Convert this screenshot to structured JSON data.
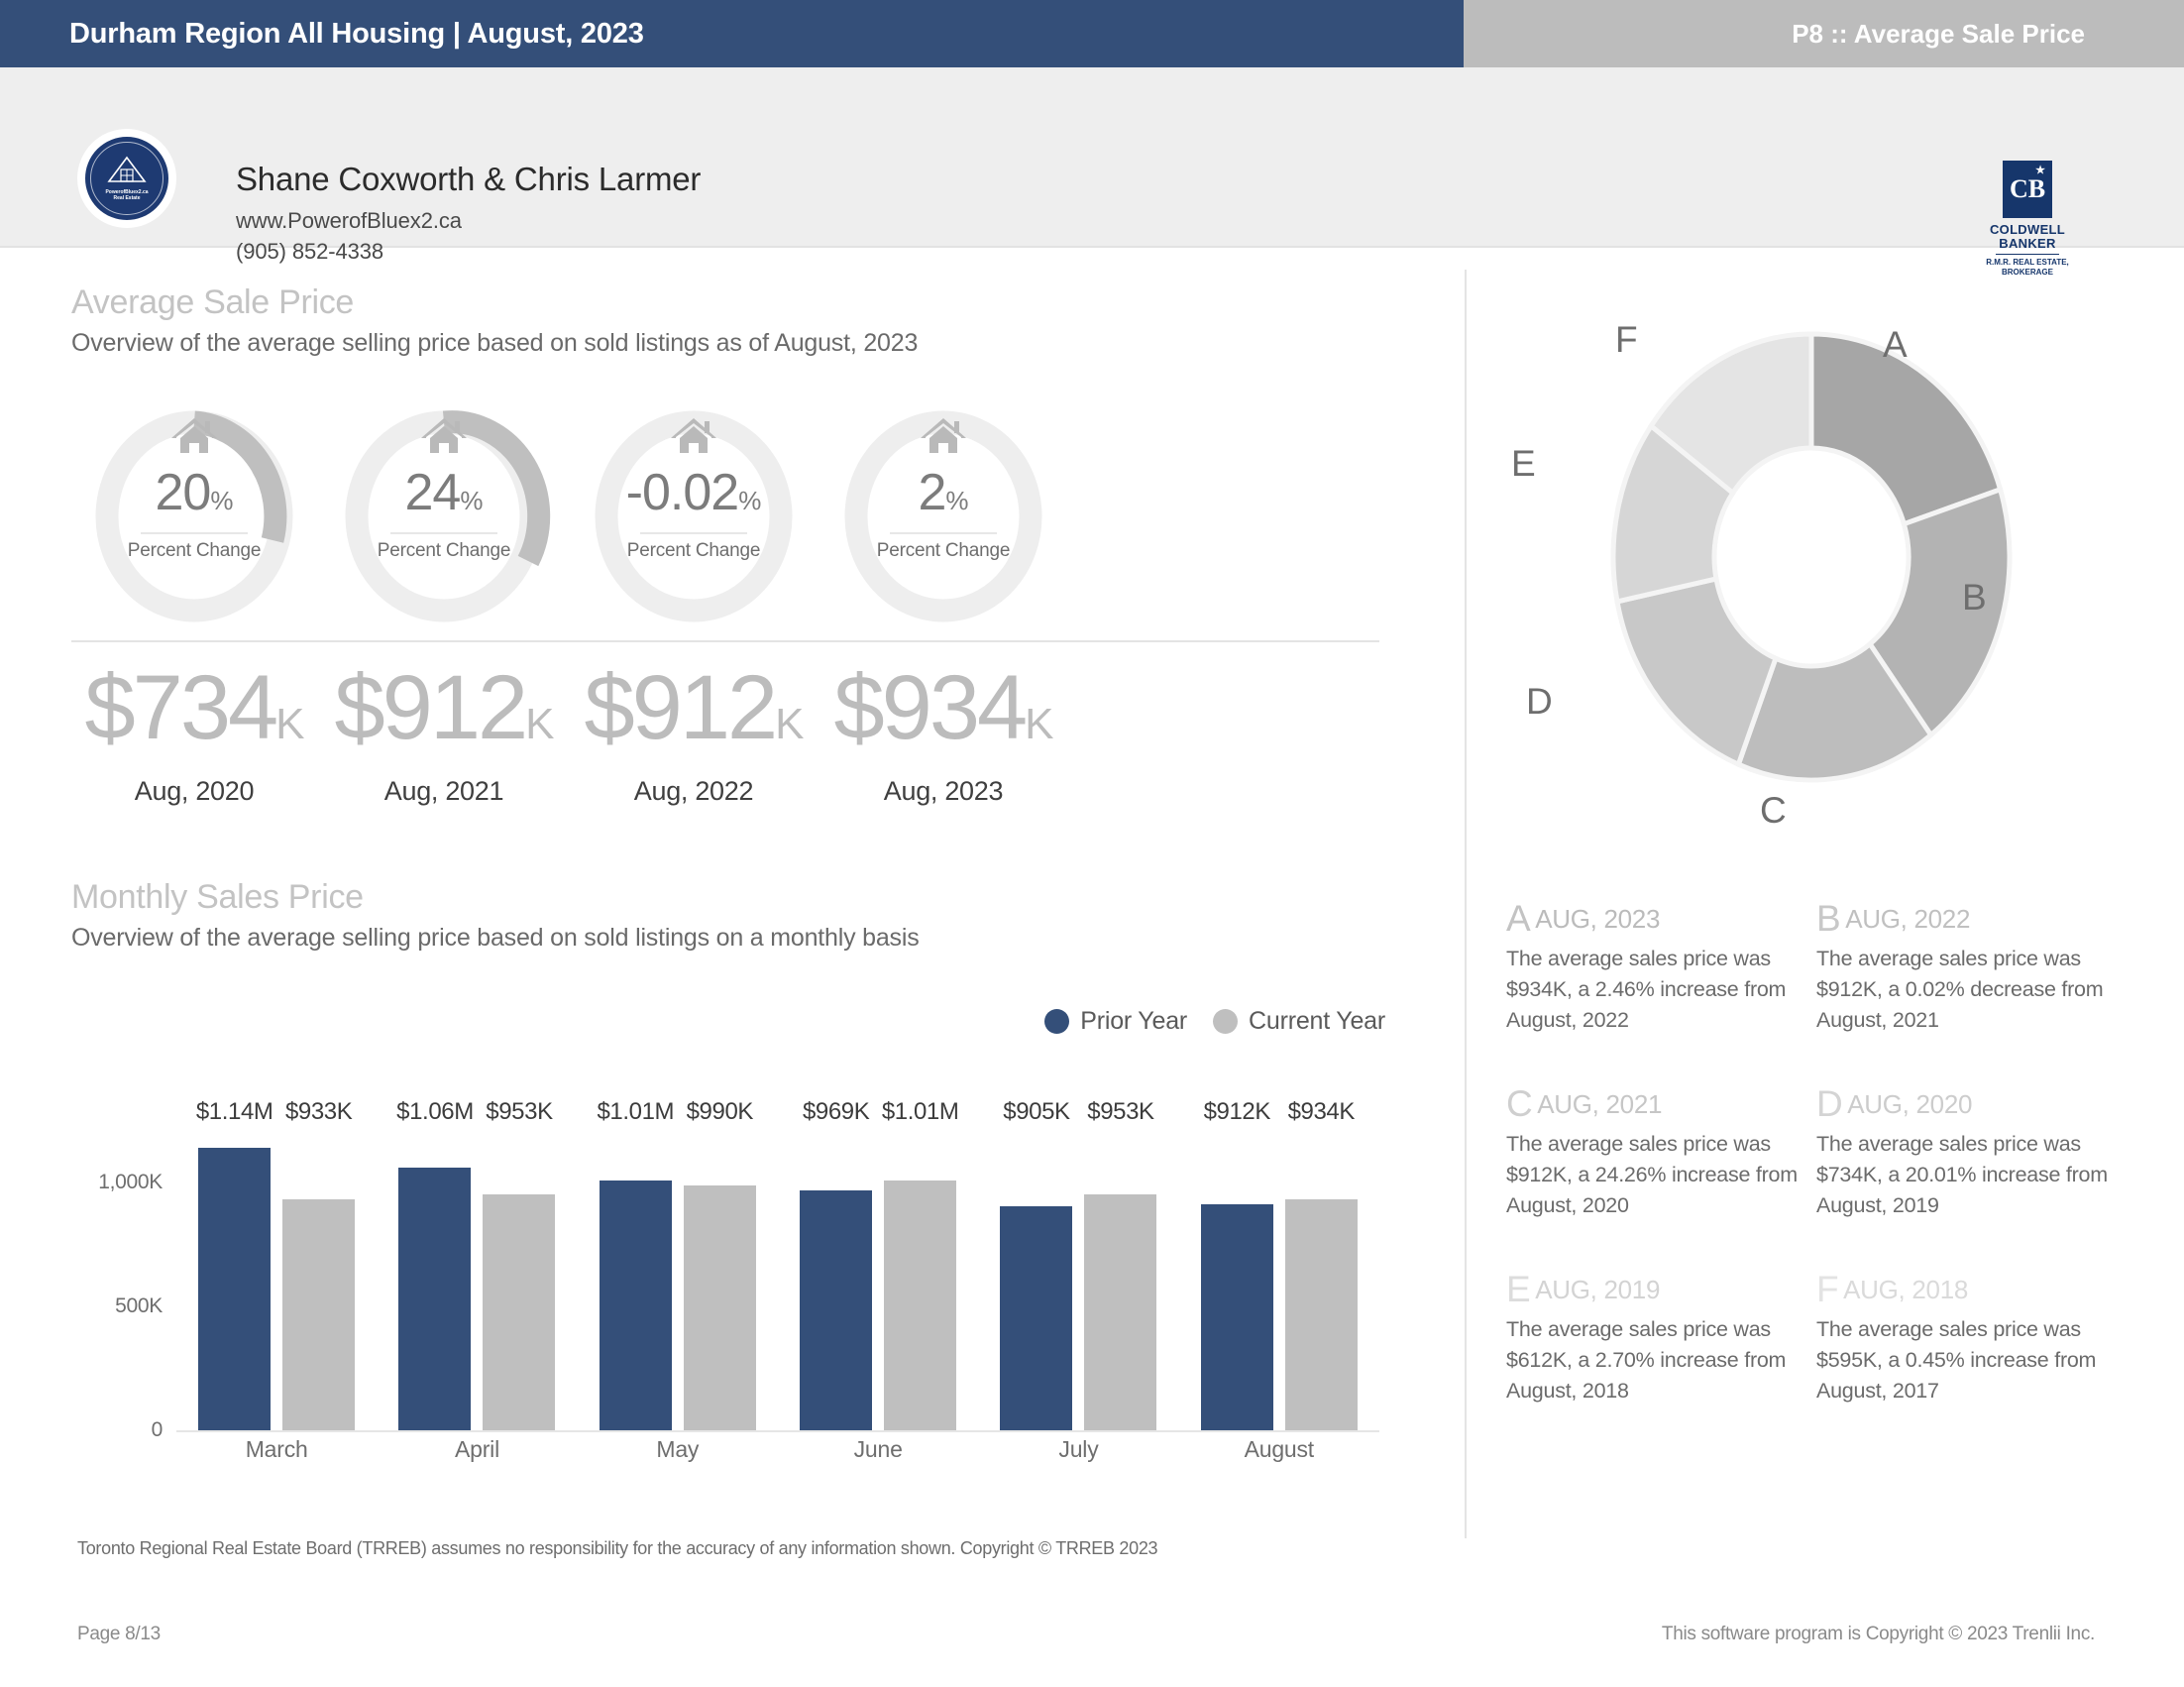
{
  "header": {
    "report_title": "Durham Region All Housing | August, 2023",
    "page_label": "P8 :: Average Sale Price",
    "brand_bar_color": "#344f79",
    "brand_bar_accent": "#bcbcbc"
  },
  "agent": {
    "name": "Shane Coxworth & Chris Larmer",
    "website": "www.PowerofBluex2.ca",
    "phone": "(905) 852-4338",
    "logo_text_line1": "PowerofBluex2.ca",
    "logo_text_line2": "Real Estate",
    "brokerage": {
      "mark": "CB",
      "name_line1": "COLDWELL",
      "name_line2": "BANKER",
      "sub_line1": "R.M.R. REAL ESTATE,",
      "sub_line2": "BROKERAGE"
    }
  },
  "average_sale_price": {
    "title": "Average Sale Price",
    "subtitle": "Overview of the average selling price based on sold listings as of August, 2023",
    "gauge_label": "Percent Change",
    "gauges": [
      {
        "value": "20",
        "pct_symbol": "%",
        "percent": 20.01,
        "price": "$734",
        "unit": "K",
        "year": "Aug, 2020"
      },
      {
        "value": "24",
        "pct_symbol": "%",
        "percent": 24.26,
        "price": "$912",
        "unit": "K",
        "year": "Aug, 2021"
      },
      {
        "value": "-0.02",
        "pct_symbol": "%",
        "percent": 0.02,
        "price": "$912",
        "unit": "K",
        "year": "Aug, 2022"
      },
      {
        "value": "2",
        "pct_symbol": "%",
        "percent": 2.46,
        "price": "$934",
        "unit": "K",
        "year": "Aug, 2023"
      }
    ]
  },
  "monthly_sales_price": {
    "title": "Monthly Sales Price",
    "subtitle": "Overview of the average selling price based on sold listings on a monthly basis"
  },
  "chart_data": {
    "type": "bar",
    "title": "Monthly Sales Price",
    "subtitle": "Overview of the average selling price based on sold listings on a monthly basis",
    "categories": [
      "March",
      "April",
      "May",
      "June",
      "July",
      "August"
    ],
    "series": [
      {
        "name": "Prior Year",
        "color": "#344f79",
        "values": [
          1140000,
          1060000,
          1010000,
          969000,
          905000,
          912000
        ],
        "labels": [
          "$1.14M",
          "$1.06M",
          "$1.01M",
          "$969K",
          "$905K",
          "$912K"
        ]
      },
      {
        "name": "Current Year",
        "color": "#bfbfbf",
        "values": [
          933000,
          953000,
          990000,
          1010000,
          953000,
          934000
        ],
        "labels": [
          "$933K",
          "$953K",
          "$990K",
          "$1.01M",
          "$953K",
          "$934K"
        ]
      }
    ],
    "xlabel": "",
    "ylabel": "",
    "ylim": [
      0,
      1200000
    ],
    "yticks": [
      "0",
      "500K",
      "1,000K"
    ],
    "ytick_values": [
      0,
      500000,
      1000000
    ],
    "grid": false,
    "legend_position": "top-right"
  },
  "donut": {
    "type": "pie",
    "segments": [
      {
        "letter": "A",
        "percent": 20.1,
        "color": "#a6a6a6"
      },
      {
        "letter": "B",
        "percent": 19.6,
        "color": "#b3b3b3"
      },
      {
        "letter": "C",
        "percent": 16.3,
        "color": "#bdbdbd"
      },
      {
        "letter": "D",
        "percent": 15.8,
        "color": "#c8c8c8"
      },
      {
        "letter": "E",
        "percent": 13.2,
        "color": "#d6d6d6"
      },
      {
        "letter": "F",
        "percent": 15.0,
        "color": "#e4e4e4"
      }
    ]
  },
  "cards": [
    {
      "letter": "A",
      "period": "AUG, 2023",
      "text": "The average sales price was $934K, a 2.46% increase from August, 2022",
      "letter_color": "#c3c3c3",
      "period_color": "#bbbbbb"
    },
    {
      "letter": "B",
      "period": "AUG, 2022",
      "text": "The average sales price was $912K, a 0.02% decrease from August, 2021",
      "letter_color": "#c8c8c8",
      "period_color": "#c0c0c0"
    },
    {
      "letter": "C",
      "period": "AUG, 2021",
      "text": "The average sales price was $912K, a 24.26% increase from August, 2020",
      "letter_color": "#cfcfcf",
      "period_color": "#c6c6c6"
    },
    {
      "letter": "D",
      "period": "AUG, 2020",
      "text": "The average sales price was $734K, a 20.01% increase from August, 2019",
      "letter_color": "#d4d4d4",
      "period_color": "#cccccc"
    },
    {
      "letter": "E",
      "period": "AUG, 2019",
      "text": "The average sales price was $612K, a 2.70% increase from August, 2018",
      "letter_color": "#dcdcdc",
      "period_color": "#d3d3d3"
    },
    {
      "letter": "F",
      "period": "AUG, 2018",
      "text": "The average sales price was $595K, a 0.45% increase from August, 2017",
      "letter_color": "#e3e3e3",
      "period_color": "#dadada"
    }
  ],
  "footer": {
    "disclaimer": "Toronto Regional Real Estate Board (TRREB) assumes no responsibility for the accuracy of any information shown. Copyright © TRREB 2023",
    "page": "Page 8/13",
    "copyright": "This software program is Copyright © 2023 Trenlii Inc."
  }
}
